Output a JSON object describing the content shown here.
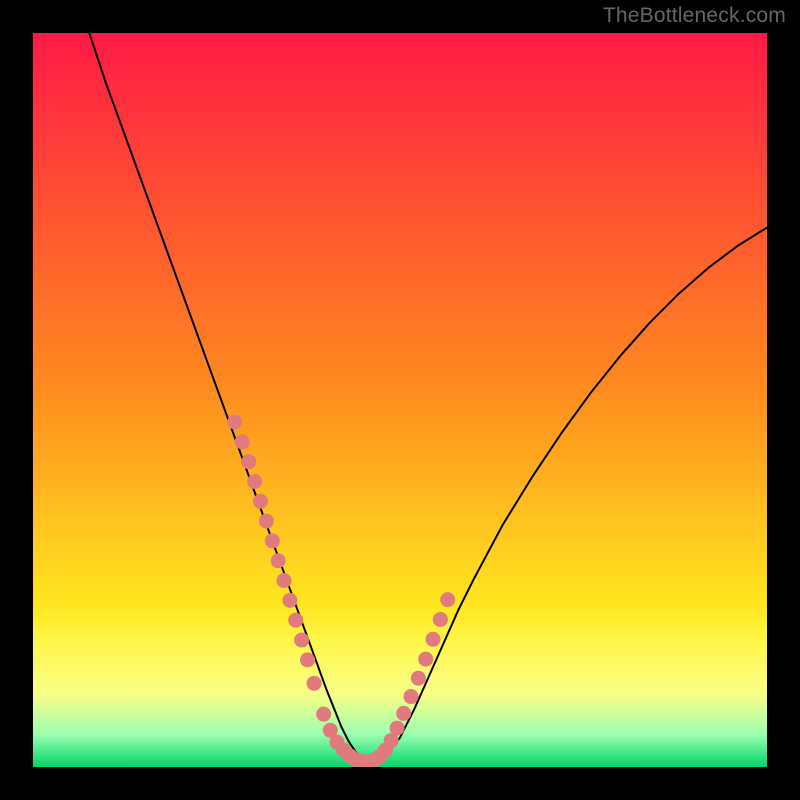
{
  "watermark": "TheBottleneck.com",
  "colors": {
    "gradient_stops": [
      {
        "offset": 0.0,
        "color": "#ff1a45"
      },
      {
        "offset": 0.48,
        "color": "#ff8a1f"
      },
      {
        "offset": 0.78,
        "color": "#ffe61f"
      },
      {
        "offset": 0.83,
        "color": "#fff64a"
      },
      {
        "offset": 0.9,
        "color": "#f9ff86"
      },
      {
        "offset": 0.955,
        "color": "#9dffb0"
      },
      {
        "offset": 1.0,
        "color": "#00d66a"
      }
    ],
    "curve": "#000000",
    "dots": "#e07a7d",
    "frame": "#000000",
    "watermark_text": "#666666"
  },
  "chart_data": {
    "type": "line",
    "title": "",
    "xlabel": "",
    "ylabel": "",
    "xlim": [
      0,
      100
    ],
    "ylim": [
      0,
      100
    ],
    "curve": {
      "x": [
        6,
        8,
        10,
        12,
        14,
        16,
        18,
        20,
        22,
        24,
        26,
        28,
        30,
        32,
        34,
        36,
        38,
        40,
        41,
        42,
        43,
        44,
        46,
        48,
        50,
        52,
        54,
        56,
        58,
        60,
        64,
        68,
        72,
        76,
        80,
        84,
        88,
        92,
        96,
        100
      ],
      "y": [
        105,
        99,
        93,
        87.5,
        82,
        76.5,
        71,
        65.5,
        60,
        54.5,
        49,
        43.5,
        38,
        32.5,
        27,
        21.5,
        16,
        10.5,
        8,
        5.5,
        3.5,
        2,
        0.7,
        1.5,
        4,
        8,
        12.5,
        17,
        21.5,
        25.5,
        33,
        39.5,
        45.5,
        51,
        56,
        60.5,
        64.5,
        68,
        71,
        73.5
      ]
    },
    "dots": {
      "x": [
        27.5,
        28.5,
        29.4,
        30.2,
        31.0,
        31.8,
        32.6,
        33.4,
        34.2,
        35.0,
        35.8,
        36.6,
        37.4,
        38.3,
        39.6,
        40.5,
        41.4,
        42.3,
        43.2,
        44.0,
        44.8,
        45.6,
        46.4,
        47.2,
        48.0,
        48.8,
        49.6,
        50.5,
        51.5,
        52.5,
        53.5,
        54.5,
        55.5,
        56.5
      ],
      "y": [
        47.0,
        44.3,
        41.6,
        38.9,
        36.2,
        33.5,
        30.8,
        28.1,
        25.4,
        22.7,
        20.0,
        17.3,
        14.6,
        11.4,
        7.2,
        5.0,
        3.4,
        2.3,
        1.5,
        1.0,
        0.8,
        0.7,
        0.9,
        1.4,
        2.3,
        3.6,
        5.3,
        7.3,
        9.6,
        12.1,
        14.7,
        17.4,
        20.1,
        22.8
      ]
    }
  }
}
